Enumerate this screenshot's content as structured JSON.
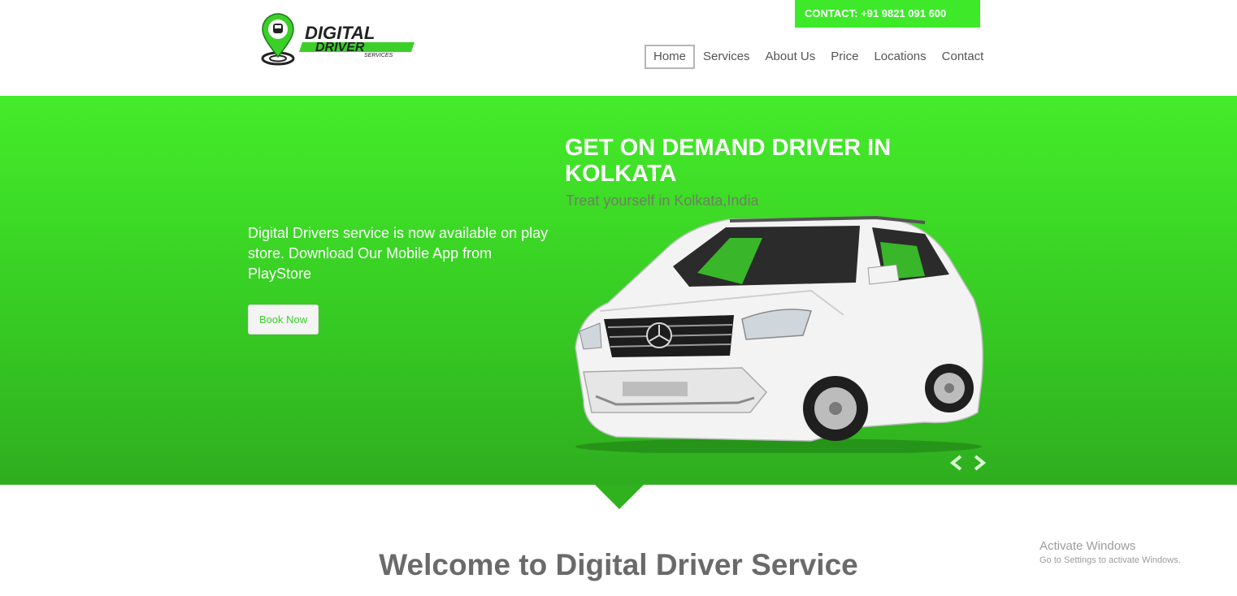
{
  "header": {
    "logo": {
      "line1": "DIGITAL",
      "line2": "DRIVER",
      "line3": "SERVICES"
    },
    "contact": "CONTACT: +91 9821 091 600",
    "nav": [
      "Home",
      "Services",
      "About Us",
      "Price",
      "Locations",
      "Contact"
    ]
  },
  "hero": {
    "title": "GET ON DEMAND DRIVER IN KOLKATA",
    "subtitle": "Treat yourself in Kolkata,India",
    "description": "Digital Drivers service is now available on play store. Download Our Mobile App from PlayStore",
    "button": "Book Now",
    "prev_icon": "chevron-left-icon",
    "next_icon": "chevron-right-icon"
  },
  "welcome": {
    "title": "Welcome to Digital Driver Service"
  },
  "watermark": {
    "title": "Activate Windows",
    "subtitle": "Go to Settings to activate Windows."
  },
  "colors": {
    "brand_green": "#3ee92a",
    "dark_green": "#2fae1f",
    "text_gray": "#555555"
  }
}
